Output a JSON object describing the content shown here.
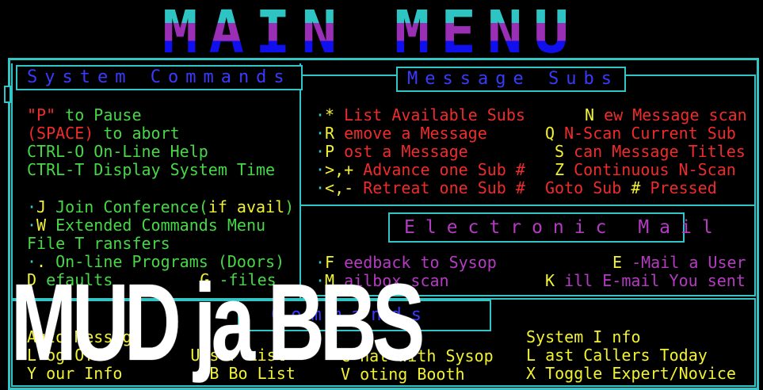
{
  "banner": {
    "text": "MAIN MENU"
  },
  "system_commands": {
    "title": "System Commands",
    "lines": [
      {
        "key": "\"P\"",
        "text": " to Pause"
      },
      {
        "key": "(SPACE)",
        "text": " to abort"
      },
      {
        "text": "CTRL-O On-Line Help"
      },
      {
        "text": "CTRL-T Display System Time"
      }
    ],
    "menu": [
      {
        "bullet": "·",
        "key": "J",
        "text": " Join Conference(",
        "extra": "if avail",
        "tail": ")"
      },
      {
        "bullet": "·",
        "key": "W",
        "text": " Extended Commands Menu"
      },
      {
        "text": "File  T ransfers"
      },
      {
        "bullet": "·",
        "key": ".",
        "text": " On-line Programs (Doors)"
      },
      {
        "key": "D",
        "text": " efaults",
        "col2_key": "G",
        "col2_text": " -files"
      }
    ]
  },
  "message_subs": {
    "title": "Message Subs",
    "rows": [
      {
        "k1": "*",
        "t1": "  List Available Subs",
        "k2": "N",
        "t2": " ew Message scan"
      },
      {
        "k1": "R",
        "t1": " emove a Message",
        "k2": "Q",
        "t2": "  N-Scan Current Sub"
      },
      {
        "k1": "P",
        "t1": " ost a Message",
        "k2": "S",
        "t2": " can Message Titles"
      },
      {
        "k1": ">,+",
        "t1": "  Advance one Sub #",
        "k2": "Z",
        "t2": "  Continuous N-Scan"
      },
      {
        "k1": "<,-",
        "t1": "  Retreat one Sub #",
        "k2": "Goto Sub",
        "k3": "#",
        "t2": " Pressed"
      }
    ]
  },
  "electronic_mail": {
    "title": "Electronic Mail",
    "rows": [
      {
        "k1": "F",
        "t1": " eedback to Sysop",
        "k2": "E",
        "t2": " -Mail a User"
      },
      {
        "k1": "M",
        "t1": " ailbox scan",
        "k2": "K",
        "t2": " ill E-mail You sent"
      }
    ]
  },
  "misc_commands": {
    "title": "Commands",
    "left": [
      {
        "text": "Auto Message"
      },
      {
        "key": "L",
        "text": " og Off",
        "col2_key": "U",
        "col2_text": " ser List"
      },
      {
        "key": "Y",
        "text": " our Info",
        "col2_key": "B",
        "col2_text": " Bo List"
      }
    ],
    "middle": [
      {
        "key": "C",
        "text": " hat with Sysop"
      },
      {
        "key": "V",
        "text": " oting Booth"
      }
    ],
    "right": [
      {
        "text": "System ",
        "key": "I",
        "tail": " nfo"
      },
      {
        "key": "L",
        "text": " ast Callers Today"
      },
      {
        "key": "X",
        "text": " Toggle Expert/Novice"
      }
    ]
  },
  "overlay_caption": "MUD ja BBS",
  "colors": {
    "frame": "#33c4c6",
    "hotkey": "#f2f230",
    "red_text": "#ef2b2b",
    "green_text": "#46d846",
    "magenta_text": "#b53bc2",
    "title_blue": "#3a3aff"
  }
}
